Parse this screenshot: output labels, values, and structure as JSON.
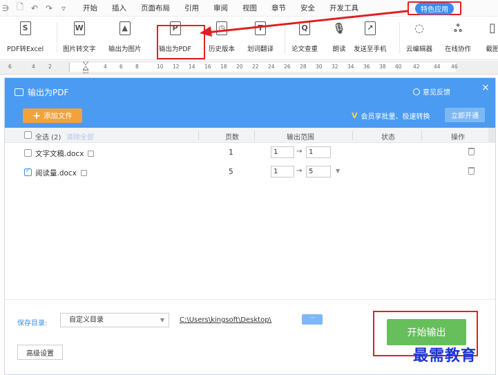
{
  "menubar": {
    "quick_access": [
      "∋",
      "🗋",
      "↶",
      "↷",
      "▿"
    ],
    "items": [
      "开始",
      "插入",
      "页面布局",
      "引用",
      "审阅",
      "视图",
      "章节",
      "安全",
      "开发工具"
    ],
    "special": "特色应用"
  },
  "ribbon": {
    "tools": [
      {
        "label": "PDF转Excel",
        "icon": "pdf-to-excel-icon",
        "glyph": "S"
      },
      {
        "label": "图片转文字",
        "icon": "image-to-text-icon",
        "glyph": "W"
      },
      {
        "label": "输出为图片",
        "icon": "export-image-icon",
        "glyph": "▲"
      },
      {
        "label": "输出为PDF",
        "icon": "export-pdf-icon",
        "glyph": "P"
      },
      {
        "label": "历史版本",
        "icon": "history-icon",
        "glyph": "◷"
      },
      {
        "label": "划词翻译",
        "icon": "translate-icon",
        "glyph": "T"
      },
      {
        "label": "论文查重",
        "icon": "paper-check-icon",
        "glyph": "Q"
      },
      {
        "label": "朗读",
        "icon": "read-aloud-icon",
        "glyph": "🎙"
      },
      {
        "label": "发送至手机",
        "icon": "send-phone-icon",
        "glyph": "↗"
      },
      {
        "label": "云编辑器",
        "icon": "cloud-editor-icon",
        "glyph": "◌"
      },
      {
        "label": "在线协作",
        "icon": "online-collab-icon",
        "glyph": "ஃ"
      },
      {
        "label": "截图",
        "icon": "screenshot-icon",
        "glyph": "▯"
      }
    ]
  },
  "ruler": {
    "left_ticks": [
      "6",
      "4",
      "2"
    ],
    "ticks": [
      "4",
      "6",
      "8",
      "10",
      "12",
      "14",
      "16",
      "18",
      "20",
      "22",
      "24",
      "26",
      "28",
      "30",
      "32",
      "34",
      "36",
      "38",
      "40",
      "42",
      "44",
      "46"
    ]
  },
  "dialog": {
    "title": "输出为PDF",
    "feedback": "意见反馈",
    "close": "×",
    "add_file": "添加文件",
    "vip_text": "会员享批量、极速转换",
    "open_now": "立即开通",
    "columns": {
      "select_all": "全选 (2)",
      "clear_all": "清除全部",
      "pages": "页数",
      "range": "输出范围",
      "status": "状态",
      "action": "操作"
    },
    "files": [
      {
        "name": "文字文稿.docx",
        "pages": "1",
        "from": "1",
        "to": "1",
        "checked": false
      },
      {
        "name": "阅读量.docx",
        "pages": "5",
        "from": "1",
        "to": "5",
        "checked": true
      }
    ],
    "save_label": "保存目录:",
    "save_option": "自定义目录",
    "save_path": "C:\\Users\\kingsoft\\Desktop\\",
    "more": "···",
    "start": "开始输出",
    "advanced": "高级设置"
  },
  "watermark": "最需教育",
  "colors": {
    "accent": "#4a9bf1",
    "highlight": "#e02020",
    "start": "#67bf5c",
    "add": "#f3a23a"
  }
}
